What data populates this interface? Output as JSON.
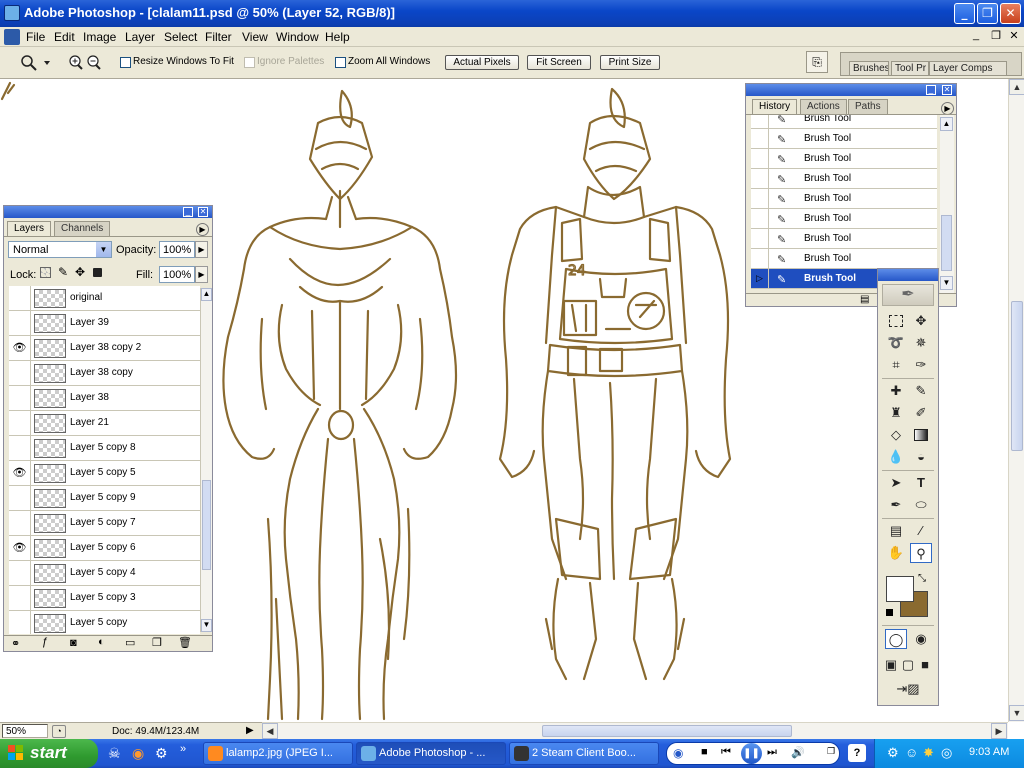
{
  "window": {
    "title": "Adobe Photoshop - [clalam11.psd @ 50% (Layer 52, RGB/8)]",
    "minimize": "_",
    "restore": "❐",
    "close": "✕",
    "doc_minimize": "_",
    "doc_restore": "❐",
    "doc_close": "✕"
  },
  "menu": [
    "File",
    "Edit",
    "Image",
    "Layer",
    "Select",
    "Filter",
    "View",
    "Window",
    "Help"
  ],
  "options_bar": {
    "resize_windows": "Resize Windows To Fit",
    "ignore_palettes": "Ignore Palettes",
    "zoom_all": "Zoom All Windows",
    "actual_pixels": "Actual Pixels",
    "fit_screen": "Fit Screen",
    "print_size": "Print Size",
    "palette_well_tabs": [
      "Brushes",
      "Tool Pr",
      "Layer Comps"
    ]
  },
  "layers_panel": {
    "tabs": [
      "Layers",
      "Channels"
    ],
    "blend_mode": "Normal",
    "opacity_label": "Opacity:",
    "opacity_value": "100%",
    "lock_label": "Lock:",
    "fill_label": "Fill:",
    "fill_value": "100%",
    "layers": [
      {
        "name": "original",
        "visible": false
      },
      {
        "name": "Layer 39",
        "visible": false
      },
      {
        "name": "Layer 38 copy 2",
        "visible": true
      },
      {
        "name": "Layer 38 copy",
        "visible": false
      },
      {
        "name": "Layer 38",
        "visible": false
      },
      {
        "name": "Layer 21",
        "visible": false
      },
      {
        "name": "Layer 5 copy 8",
        "visible": false
      },
      {
        "name": "Layer 5 copy 5",
        "visible": true
      },
      {
        "name": "Layer 5 copy 9",
        "visible": false
      },
      {
        "name": "Layer 5 copy 7",
        "visible": false
      },
      {
        "name": "Layer 5 copy 6",
        "visible": true
      },
      {
        "name": "Layer 5 copy 4",
        "visible": false
      },
      {
        "name": "Layer 5 copy 3",
        "visible": false
      },
      {
        "name": "Layer 5 copy",
        "visible": false
      }
    ]
  },
  "history_panel": {
    "tabs": [
      "History",
      "Actions",
      "Paths"
    ],
    "items": [
      "Brush Tool",
      "Brush Tool",
      "Brush Tool",
      "Brush Tool",
      "Brush Tool",
      "Brush Tool",
      "Brush Tool",
      "Brush Tool",
      "Brush Tool"
    ],
    "selected": "Brush Tool"
  },
  "status": {
    "zoom": "50%",
    "doc": "Doc: 49.4M/123.4M"
  },
  "colors": {
    "sketch": "#8a6a30",
    "foreground": "#ffffff",
    "background": "#8a6a30"
  },
  "taskbar": {
    "start": "start",
    "buttons": [
      "lalamp2.jpg (JPEG I...",
      "Adobe Photoshop - ...",
      "2 Steam Client Boo..."
    ],
    "clock": "9:03 AM"
  }
}
